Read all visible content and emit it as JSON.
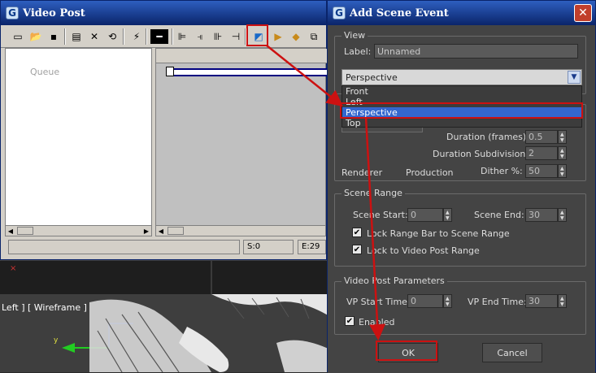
{
  "video_post": {
    "title": "Video Post",
    "queue_label": "Queue",
    "status": {
      "start": "S:0",
      "end": "E:29"
    }
  },
  "viewport": {
    "label": "Left ] [ Wireframe ]",
    "axis_y": "y"
  },
  "dialog": {
    "title": "Add Scene Event",
    "close_glyph": "✕",
    "view_group": {
      "title": "View",
      "label_caption": "Label:",
      "label_value": "Unnamed",
      "selected_view": "Perspective",
      "options": [
        "Front",
        "Left",
        "Perspective",
        "Top"
      ]
    },
    "render": {
      "duration_label": "Duration (frames):",
      "duration_value": "0.5",
      "subdiv_label": "Duration Subdivisions:",
      "subdiv_value": "2",
      "dither_label": "Dither %:",
      "dither_value": "50",
      "renderer_label": "Renderer",
      "renderer_value": "Production"
    },
    "scene_range": {
      "title": "Scene Range",
      "start_label": "Scene Start:",
      "start_value": "0",
      "end_label": "Scene End:",
      "end_value": "30",
      "lock_range_label": "Lock Range Bar to Scene Range",
      "lock_vp_label": "Lock to Video Post Range"
    },
    "vp_params": {
      "title": "Video Post Parameters",
      "start_label": "VP Start Time:",
      "start_value": "0",
      "end_label": "VP End Time:",
      "end_value": "30",
      "enabled_label": "Enabled"
    },
    "ok_label": "OK",
    "cancel_label": "Cancel"
  },
  "colors": {
    "annotation": "#cc1111",
    "title_bar": "#0a246a",
    "dialog_bg": "#444444",
    "selection": "#3367cf"
  }
}
